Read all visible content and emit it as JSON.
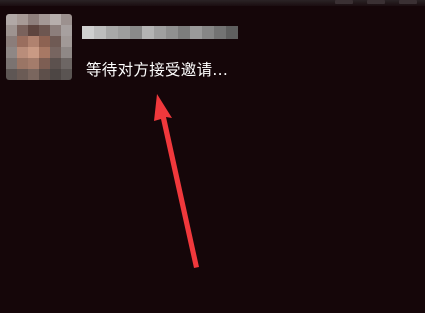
{
  "call": {
    "status_text": "等待对方接受邀请..."
  },
  "avatar": {
    "icon": "pixelated-avatar-icon"
  },
  "contact_name": {
    "icon": "pixelated-name-block"
  },
  "annotation": {
    "icon": "red-arrow-icon",
    "color": "#f0383c"
  },
  "colors": {
    "background": "#150609",
    "text": "#ffffff",
    "arrow": "#f0383c"
  }
}
